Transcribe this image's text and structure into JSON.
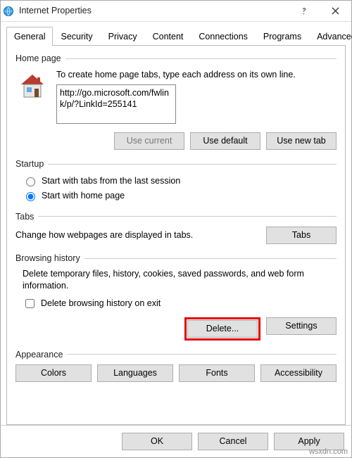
{
  "title": "Internet Properties",
  "tabs": [
    "General",
    "Security",
    "Privacy",
    "Content",
    "Connections",
    "Programs",
    "Advanced"
  ],
  "homepage": {
    "header": "Home page",
    "hint": "To create home page tabs, type each address on its own line.",
    "url": "http://go.microsoft.com/fwlink/p/?LinkId=255141",
    "use_current": "Use current",
    "use_default": "Use default",
    "use_new_tab": "Use new tab"
  },
  "startup": {
    "header": "Startup",
    "opt_last": "Start with tabs from the last session",
    "opt_home": "Start with home page"
  },
  "tabs_section": {
    "header": "Tabs",
    "desc": "Change how webpages are displayed in tabs.",
    "btn": "Tabs"
  },
  "history": {
    "header": "Browsing history",
    "desc": "Delete temporary files, history, cookies, saved passwords, and web form information.",
    "chk": "Delete browsing history on exit",
    "delete": "Delete...",
    "settings": "Settings"
  },
  "appearance": {
    "header": "Appearance",
    "colors": "Colors",
    "languages": "Languages",
    "fonts": "Fonts",
    "accessibility": "Accessibility"
  },
  "footer": {
    "ok": "OK",
    "cancel": "Cancel",
    "apply": "Apply"
  },
  "watermark": "wsxdn.com"
}
